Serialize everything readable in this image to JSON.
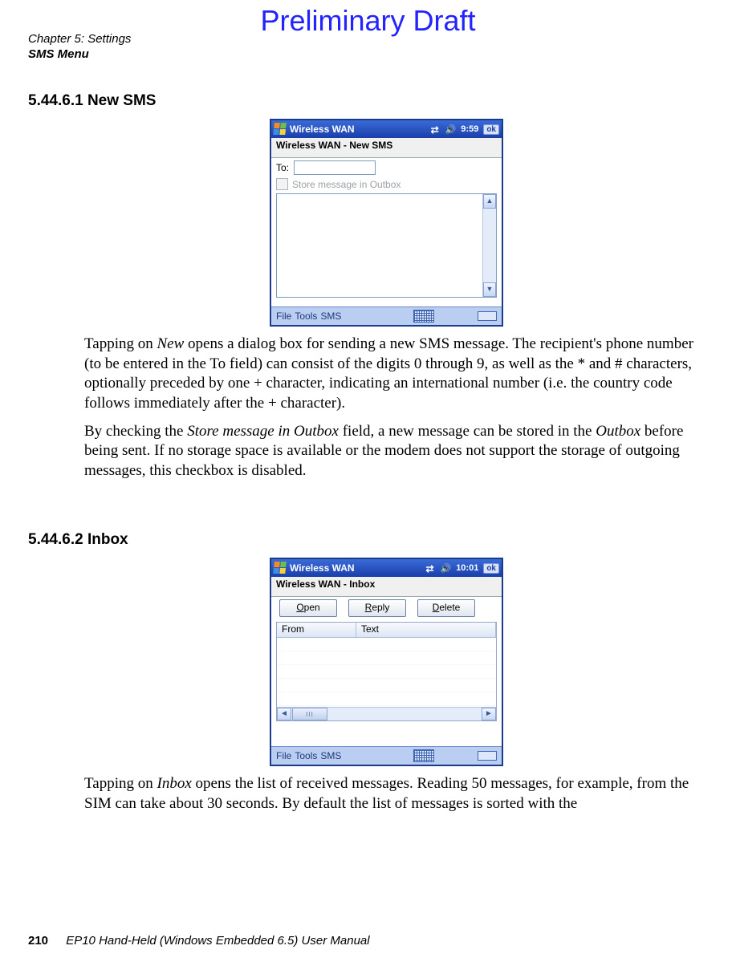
{
  "watermark": "Preliminary Draft",
  "header": {
    "line1": "Chapter 5: Settings",
    "line2": "SMS Menu"
  },
  "sections": {
    "s1_heading": "5.44.6.1 New SMS",
    "s2_heading": "5.44.6.2 Inbox"
  },
  "paragraphs": {
    "p1a_pre": "Tapping on ",
    "p1a_em1": "New",
    "p1a_post": " opens a dialog box for sending a new SMS message. The recipient's phone number (to be entered in the To field) can consist of the digits 0 through 9, as well as the * and # characters, optionally preceded by one + character, indicating an international number (i.e. the country code follows immediately after the + character).",
    "p1b_pre": "By checking the ",
    "p1b_em1": "Store message in Outbox",
    "p1b_mid": " field, a new message can be stored in the ",
    "p1b_em2": "Outbox",
    "p1b_post": " before being sent. If no storage space is available or the modem does not support the storage of outgoing messages, this checkbox is disabled.",
    "p2_pre": "Tapping on ",
    "p2_em1": "Inbox",
    "p2_post": " opens the list of received messages. Reading 50 messages, for example, from the SIM can take about 30 seconds. By default the list of messages is sorted with the"
  },
  "footer": {
    "page": "210",
    "title": "EP10 Hand-Held (Windows Embedded 6.5) User Manual"
  },
  "device1": {
    "titlebar": {
      "title": "Wireless WAN",
      "time": "9:59",
      "ok": "ok"
    },
    "subheader": "Wireless WAN - New SMS",
    "to_label": "To:",
    "store_label": "Store message in Outbox",
    "menubar": {
      "file": "File",
      "tools": "Tools",
      "sms": "SMS"
    }
  },
  "device2": {
    "titlebar": {
      "title": "Wireless WAN",
      "time": "10:01",
      "ok": "ok"
    },
    "subheader": "Wireless WAN - Inbox",
    "buttons": {
      "open_u": "O",
      "open_rest": "pen",
      "reply_u": "R",
      "reply_rest": "eply",
      "delete_u": "D",
      "delete_rest": "elete"
    },
    "columns": {
      "from": "From",
      "text": "Text"
    },
    "thumb": "III",
    "menubar": {
      "file": "File",
      "tools": "Tools",
      "sms": "SMS"
    }
  }
}
